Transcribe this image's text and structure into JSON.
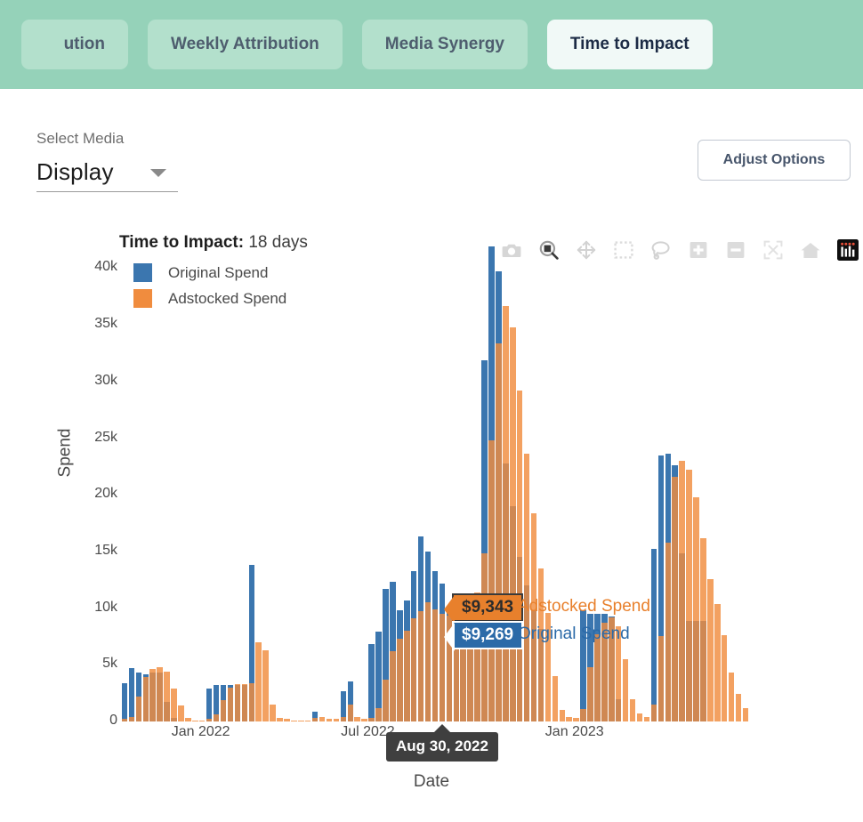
{
  "header": {
    "back_icon": "chevron-left-icon",
    "tabs": [
      {
        "label": "ution",
        "active": false,
        "clipped": true
      },
      {
        "label": "Weekly Attribution",
        "active": false,
        "clipped": false
      },
      {
        "label": "Media Synergy",
        "active": false,
        "clipped": false
      },
      {
        "label": "Time to Impact",
        "active": true,
        "clipped": false
      }
    ],
    "background_color": "#95d2b9",
    "tab_color": "#b3e0cc",
    "active_tab_color": "#f1f9f7"
  },
  "controls": {
    "select_media_label": "Select Media",
    "selected_media": "Display",
    "caret_icon": "chevron-down-icon",
    "adjust_options_label": "Adjust Options"
  },
  "modebar": {
    "buttons": [
      {
        "name": "download-camera-icon",
        "title": "Download plot as a png"
      },
      {
        "name": "zoom-icon",
        "title": "Zoom"
      },
      {
        "name": "pan-icon",
        "title": "Pan"
      },
      {
        "name": "box-select-icon",
        "title": "Box Select"
      },
      {
        "name": "lasso-select-icon",
        "title": "Lasso Select"
      },
      {
        "name": "zoom-in-icon",
        "title": "Zoom in"
      },
      {
        "name": "zoom-out-icon",
        "title": "Zoom out"
      },
      {
        "name": "autoscale-icon",
        "title": "Autoscale"
      },
      {
        "name": "reset-home-icon",
        "title": "Reset axes"
      },
      {
        "name": "plotly-logo-icon",
        "title": "Produced with Plotly"
      }
    ]
  },
  "tooltip": {
    "adstocked_value": "$9,343",
    "adstocked_name": "Adstocked Spend",
    "original_value": "$9,269",
    "original_name": "Original Spend",
    "x_label": "Aug 30, 2022"
  },
  "chart_data": {
    "type": "bar",
    "title": "Time to Impact:",
    "title_value": "18 days",
    "xlabel": "Date",
    "ylabel": "Spend",
    "ylim": [
      0,
      42000
    ],
    "yticks": [
      "0",
      "5k",
      "10k",
      "15k",
      "20k",
      "25k",
      "30k",
      "35k",
      "40k"
    ],
    "ytick_values": [
      0,
      5000,
      10000,
      15000,
      20000,
      25000,
      30000,
      35000,
      40000
    ],
    "xticks": [
      "Jan 2022",
      "Jul 2022",
      "Jan 2023"
    ],
    "xtick_positions": [
      0.127,
      0.393,
      0.722
    ],
    "grid": false,
    "barmode": "overlay",
    "legend_position": "top-left",
    "colors": {
      "original": "#3b76af",
      "adstocked": "#f08c3e"
    },
    "series": [
      {
        "name": "Original Spend",
        "values": [
          3400,
          4700,
          4300,
          4200,
          4300,
          4300,
          1700,
          300,
          0,
          0,
          0,
          0,
          2900,
          3200,
          3200,
          3200,
          3200,
          3200,
          13800,
          0,
          0,
          0,
          0,
          0,
          0,
          0,
          0,
          900,
          0,
          0,
          0,
          2700,
          3500,
          0,
          0,
          6800,
          7900,
          11700,
          12300,
          9800,
          10700,
          13300,
          16300,
          15000,
          13300,
          12200,
          9700,
          9600,
          9400,
          9269,
          9000,
          31900,
          41900,
          39700,
          22800,
          19000,
          14500,
          12000,
          9800,
          8200,
          0,
          0,
          0,
          0,
          0,
          9800,
          9500,
          9500,
          9500,
          9300,
          2000,
          0,
          0,
          0,
          0,
          15200,
          23500,
          23600,
          22600,
          14800,
          8900,
          8900,
          8900,
          0,
          0,
          0,
          0,
          0,
          0
        ]
      },
      {
        "name": "Adstocked Spend",
        "values": [
          200,
          400,
          2200,
          3900,
          4600,
          4800,
          4400,
          2900,
          1400,
          300,
          100,
          100,
          200,
          600,
          1900,
          3000,
          3300,
          3300,
          3400,
          7000,
          6300,
          1500,
          300,
          200,
          100,
          100,
          100,
          300,
          400,
          200,
          200,
          400,
          1500,
          400,
          200,
          300,
          1200,
          3700,
          6200,
          7300,
          8000,
          9100,
          9700,
          10500,
          9900,
          9500,
          9343,
          9343,
          9343,
          9343,
          11400,
          14800,
          24800,
          33400,
          36700,
          34800,
          29200,
          23600,
          18400,
          13500,
          9600,
          4000,
          1000,
          400,
          300,
          1100,
          4800,
          7700,
          8700,
          9200,
          8400,
          5500,
          2000,
          700,
          400,
          1500,
          7500,
          15800,
          21600,
          23000,
          22200,
          19800,
          16200,
          12600,
          10400,
          7600,
          4300,
          2400,
          1200
        ]
      }
    ]
  }
}
